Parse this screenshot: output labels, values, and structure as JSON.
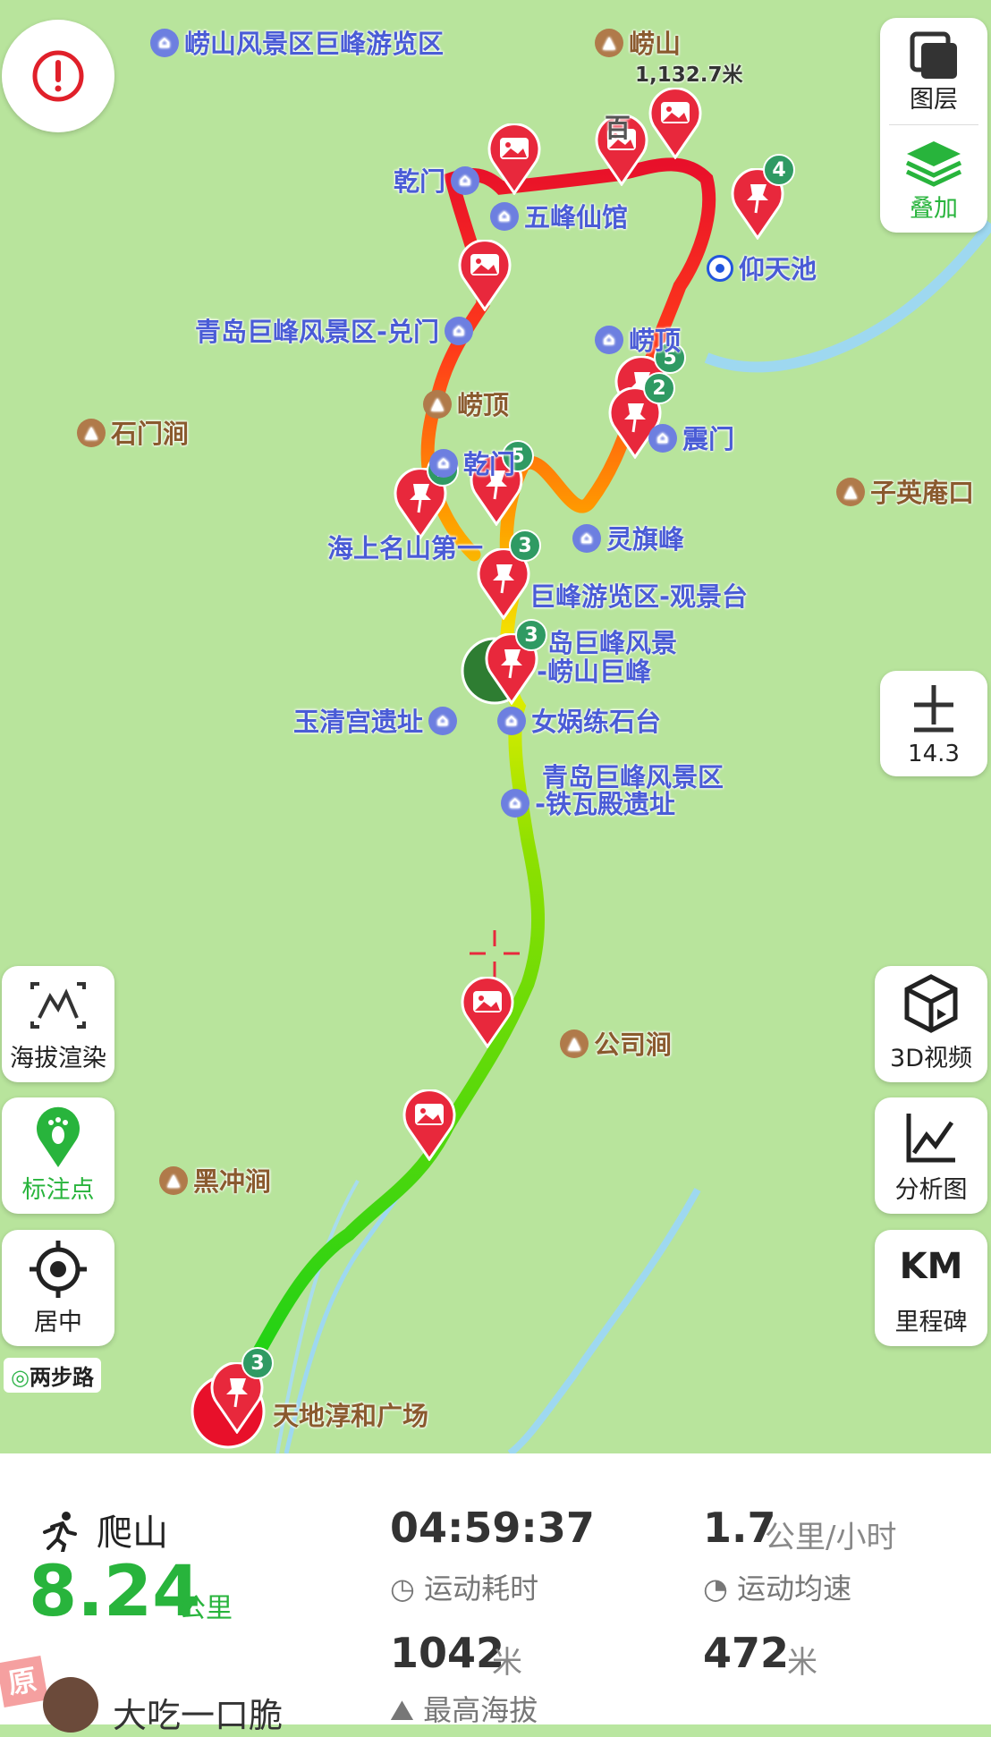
{
  "map": {
    "zoom_level": "14.3",
    "peak_elevation": "1,132.7米",
    "labels": {
      "scenic_area": "崂山风景区巨峰游览区",
      "laoshan": "崂山",
      "qianmen": "乾门",
      "wufeng": "五峰仙馆",
      "yangtianchi": "仰天池",
      "duimen": "青岛巨峰风景区-兑门",
      "laoding_top": "崂顶",
      "laoding_mtn": "崂顶",
      "shimen": "石门涧",
      "zhenmen": "震门",
      "ziying": "子英庵口",
      "kanmen": "乾门",
      "haishang": "海上名山第一",
      "lingqi": "灵旗峰",
      "guanjing": "巨峰游览区-观景台",
      "jufeng_a": "岛巨峰风景",
      "jufeng_b": "-崂山巨峰",
      "yuqing": "玉清宫遗址",
      "nvwa": "女娲练石台",
      "tiewa_a": "青岛巨峰风景区",
      "tiewa_b": "-铁瓦殿遗址",
      "gongsi": "公司涧",
      "heichong": "黑冲涧",
      "tiandi": "天地淳和广场",
      "stone_partial": "百"
    },
    "badges": [
      "4",
      "5",
      "2",
      "2",
      "5",
      "3",
      "3",
      "3"
    ],
    "brand": "两步路"
  },
  "controls": {
    "warning_icon": "exclamation-icon",
    "layers_label": "图层",
    "overlay_label": "叠加",
    "zoom_in_icon": "plus-icon",
    "elevation_label": "海拔渲染",
    "marker_label": "标注点",
    "center_label": "居中",
    "video_label": "3D视频",
    "analysis_label": "分析图",
    "km_label": "KM",
    "milestone_label": "里程碑"
  },
  "stats": {
    "activity": "爬山",
    "distance": "8.24",
    "distance_unit": "公里",
    "duration": "04:59:37",
    "duration_label": "运动耗时",
    "speed": "1.7",
    "speed_unit": "公里/小时",
    "speed_label": "运动均速",
    "max_alt": "1042",
    "max_alt_unit": "米",
    "max_alt_label": "最高海拔",
    "climb": "472",
    "climb_unit": "米",
    "user": "大吃一口脆",
    "watermark": "原"
  },
  "colors": {
    "map_bg": "#b8e49c",
    "route_red": "#e8283c",
    "route_green": "#1ed21e",
    "accent_green": "#28b43c",
    "poi_blue": "#4a5cd6",
    "badge": "#2f9a63"
  }
}
